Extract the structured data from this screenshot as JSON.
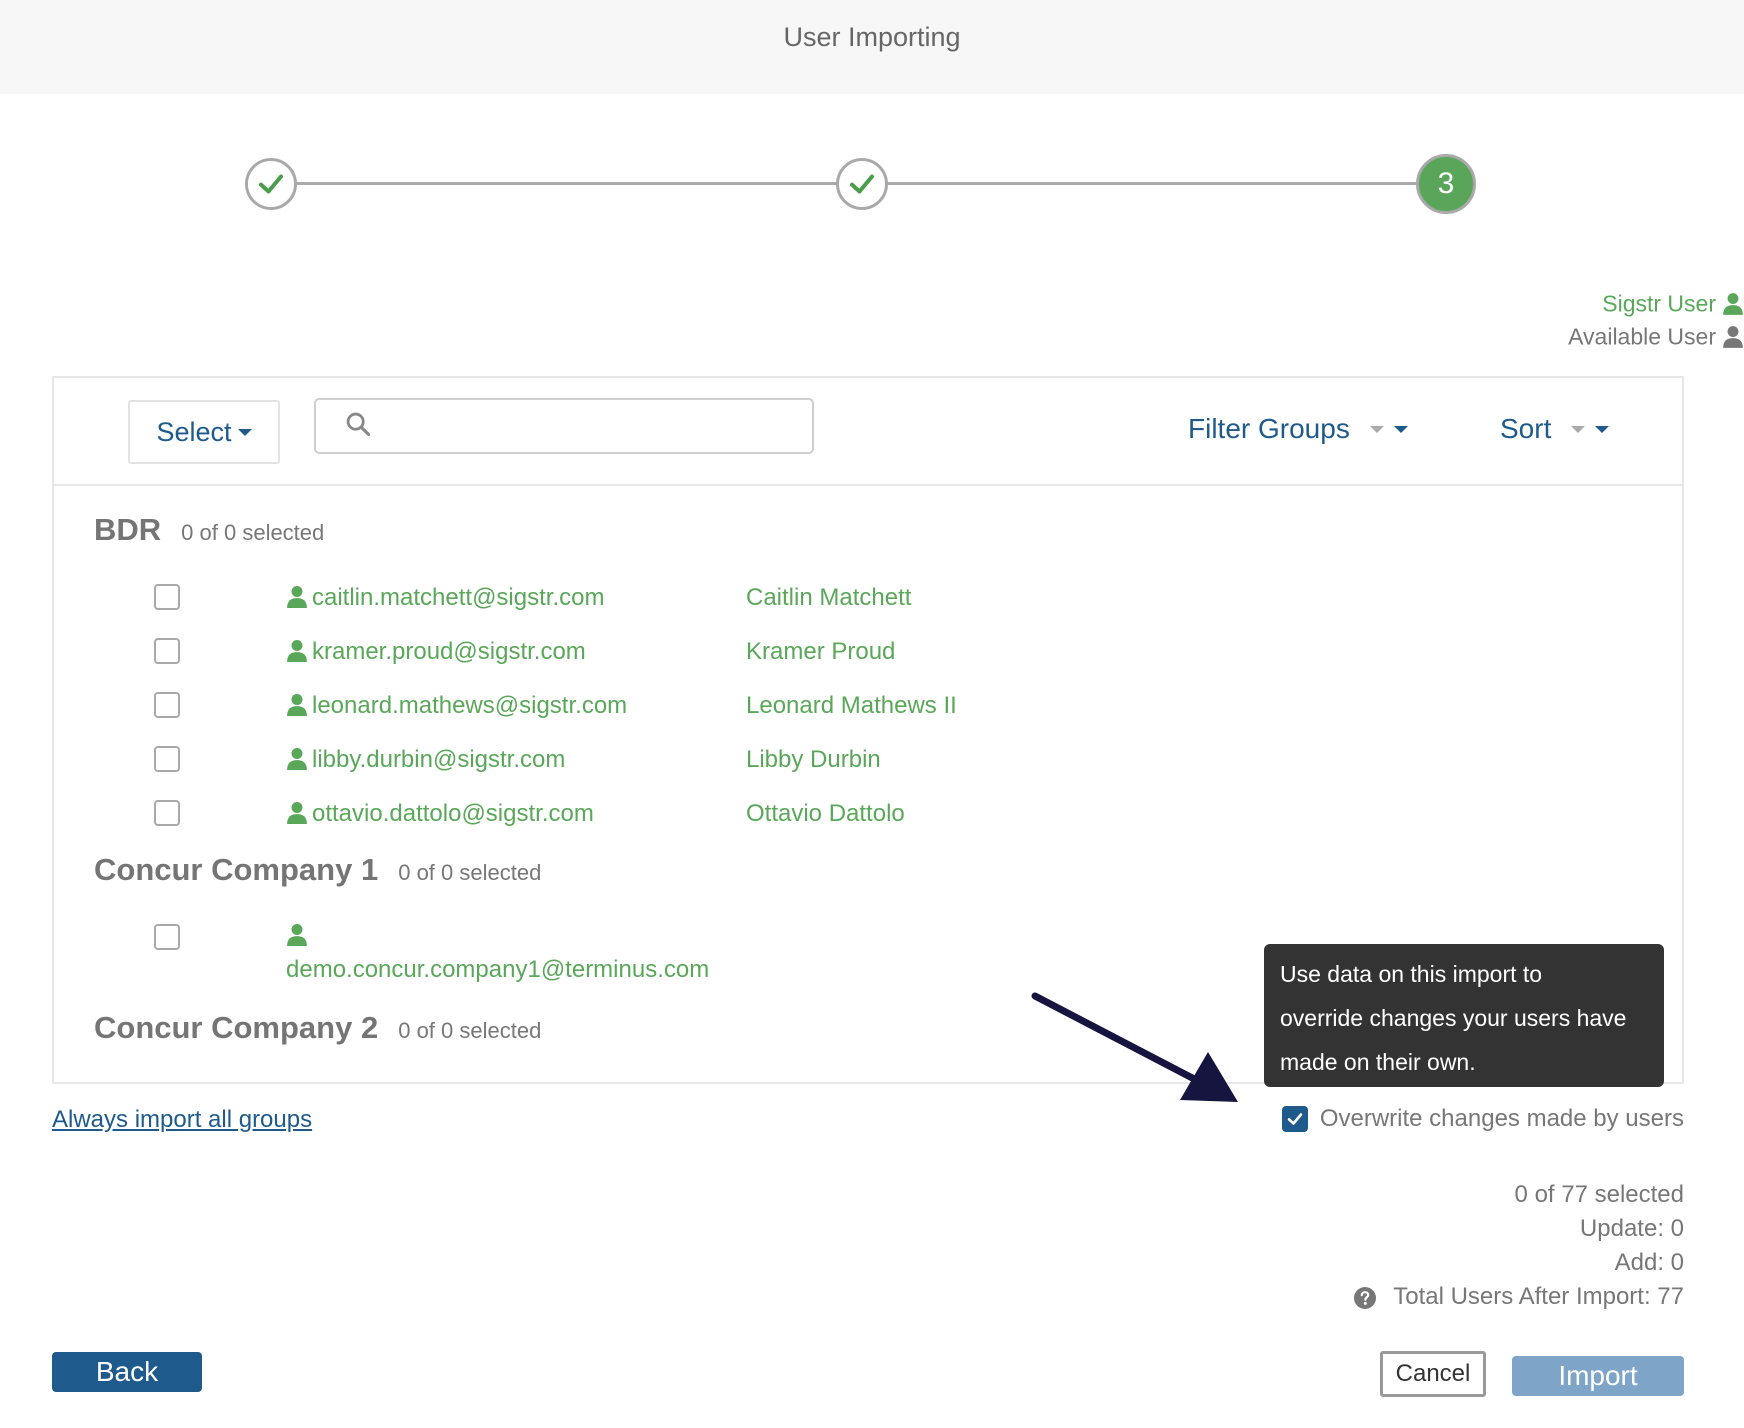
{
  "header": {
    "title": "User Importing"
  },
  "stepper": {
    "steps": [
      {
        "state": "complete",
        "icon": "check-icon"
      },
      {
        "state": "complete",
        "icon": "check-icon"
      },
      {
        "state": "active",
        "label": "3"
      }
    ]
  },
  "legend": {
    "sigstr_user": "Sigstr User",
    "available_user": "Available User"
  },
  "toolbar": {
    "select_label": "Select",
    "search_placeholder": "",
    "filter_label": "Filter Groups",
    "sort_label": "Sort"
  },
  "groups": [
    {
      "name": "BDR",
      "count": "0 of 0 selected",
      "users": [
        {
          "email": "caitlin.matchett@sigstr.com",
          "name": "Caitlin Matchett"
        },
        {
          "email": "kramer.proud@sigstr.com",
          "name": "Kramer Proud"
        },
        {
          "email": "leonard.mathews@sigstr.com",
          "name": "Leonard Mathews II"
        },
        {
          "email": "libby.durbin@sigstr.com",
          "name": "Libby Durbin"
        },
        {
          "email": "ottavio.dattolo@sigstr.com",
          "name": "Ottavio Dattolo"
        }
      ]
    },
    {
      "name": "Concur Company 1",
      "count": "0 of 0 selected",
      "users": [
        {
          "email": "demo.concur.company1@terminus.com",
          "name": ""
        }
      ]
    },
    {
      "name": "Concur Company 2",
      "count": "0 of 0 selected",
      "users": []
    }
  ],
  "always_import_link": "Always import all groups",
  "tooltip": {
    "line1": "Use data on this import to",
    "line2": "override changes your users have",
    "line3": "made on their own."
  },
  "overwrite": {
    "label": "Overwrite changes made by users",
    "checked": true
  },
  "stats": {
    "selected": "0 of 77 selected",
    "update": "Update: 0",
    "add": "Add: 0",
    "total": "Total Users After Import: 77"
  },
  "buttons": {
    "back": "Back",
    "cancel": "Cancel",
    "import": "Import"
  },
  "colors": {
    "primary": "#1e5a8c",
    "sigstr_green": "#5aa75a",
    "tooltip_bg": "#333333",
    "import_disabled": "#7ea4c8"
  }
}
